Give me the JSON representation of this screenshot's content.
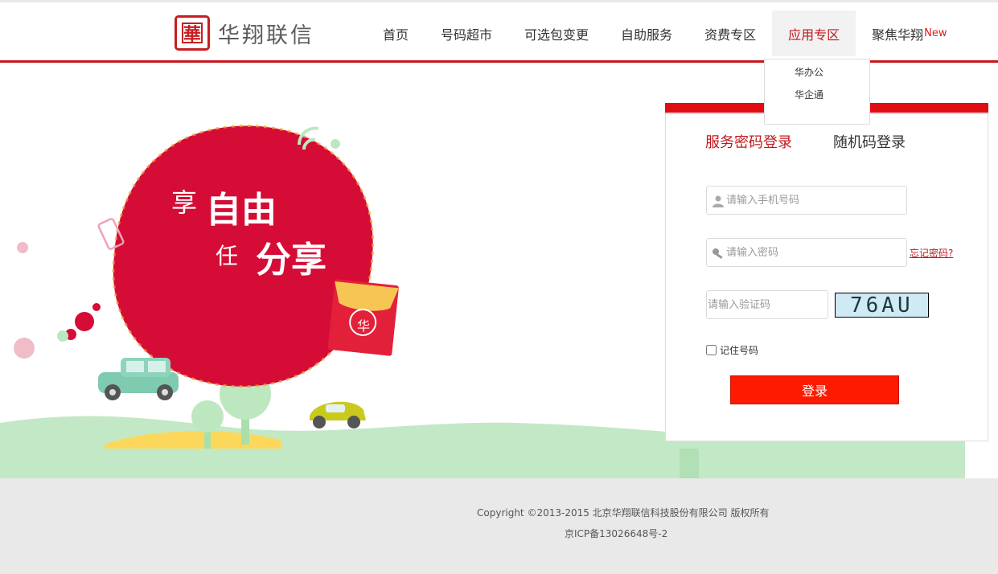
{
  "brand": {
    "logo_char": "華",
    "name": "华翔联信"
  },
  "nav": {
    "items": [
      {
        "label": "首页"
      },
      {
        "label": "号码超市"
      },
      {
        "label": "可选包变更"
      },
      {
        "label": "自助服务"
      },
      {
        "label": "资费专区"
      },
      {
        "label": "应用专区",
        "active": true
      },
      {
        "label": "聚焦华翔",
        "badge": "New"
      }
    ],
    "dropdown": [
      "华办公",
      "华企通"
    ]
  },
  "hero": {
    "slogan_line1_small": "享",
    "slogan_line1_big": "自由",
    "slogan_line2_small": "任",
    "slogan_line2_big": "分享",
    "envelope_char": "华"
  },
  "login": {
    "tab_password": "服务密码登录",
    "tab_random": "随机码登录",
    "phone_placeholder": "请输入手机号码",
    "password_placeholder": "请输入密码",
    "forgot": "忘记密码?",
    "code_placeholder": "请输入验证码",
    "captcha": "76AU",
    "remember": "记住号码",
    "submit": "登录"
  },
  "footer": {
    "copyright": "Copyright ©2013-2015 北京华翔联信科技股份有限公司 版权所有",
    "icp": "京ICP备13026648号-2"
  },
  "colors": {
    "brand_red": "#c3171d",
    "button_red": "#fe1a00",
    "footer_bg": "#e9e9e9"
  }
}
